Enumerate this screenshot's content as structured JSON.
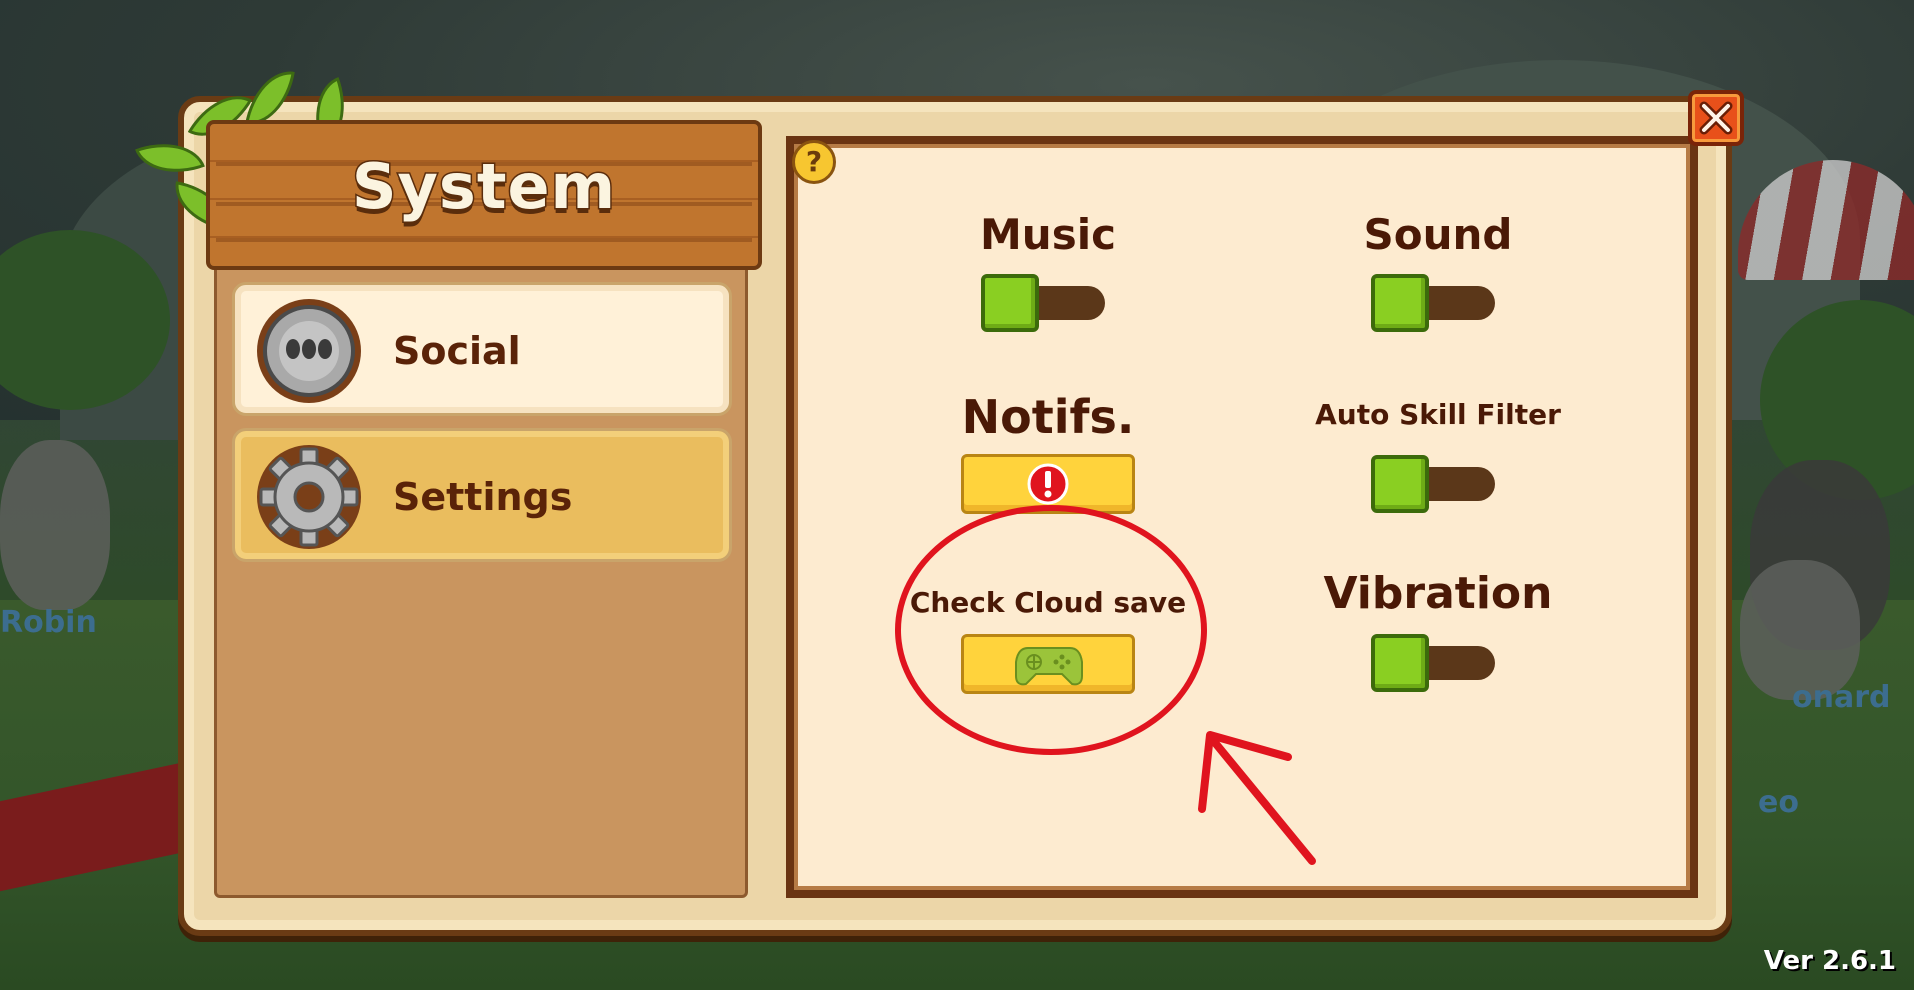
{
  "window": {
    "title": "System"
  },
  "background": {
    "names": [
      "Robin",
      "onard",
      "eo"
    ]
  },
  "version": "Ver 2.6.1",
  "sidebar": {
    "items": [
      {
        "label": "Social",
        "icon": "stone-wheel-icon",
        "selected": false
      },
      {
        "label": "Settings",
        "icon": "gear-icon",
        "selected": true
      }
    ]
  },
  "settings": {
    "music": {
      "label": "Music",
      "on": true
    },
    "sound": {
      "label": "Sound",
      "on": true
    },
    "notifs": {
      "label": "Notifs.",
      "icon": "exclamation-icon"
    },
    "auto_skill_filter": {
      "label": "Auto Skill Filter",
      "on": true
    },
    "cloud_save": {
      "label": "Check Cloud save",
      "icon": "gamepad-icon"
    },
    "vibration": {
      "label": "Vibration",
      "on": true
    }
  },
  "buttons": {
    "help": "?",
    "close": "close-icon"
  },
  "colors": {
    "accent_yellow": "#ffd33c",
    "toggle_green": "#8acf22",
    "title_wood": "#c0752e",
    "annotation_red": "#e0141e"
  }
}
